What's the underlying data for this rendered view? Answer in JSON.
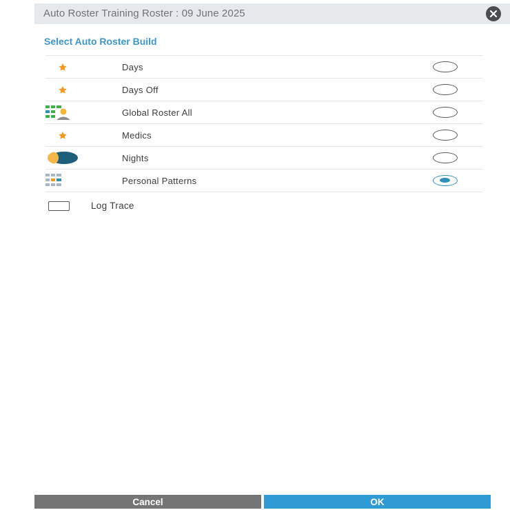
{
  "dialog": {
    "title": "Auto Roster Training Roster : 09 June 2025",
    "close_icon": "close-circle-icon"
  },
  "section": {
    "title": "Select Auto Roster Build"
  },
  "options": [
    {
      "label": "Days",
      "icon": "star-icon",
      "selected": false
    },
    {
      "label": "Days Off",
      "icon": "star-icon",
      "selected": false
    },
    {
      "label": "Global Roster All",
      "icon": "roster-person-icon",
      "selected": false
    },
    {
      "label": "Medics",
      "icon": "star-icon",
      "selected": false
    },
    {
      "label": "Nights",
      "icon": "moon-icon",
      "selected": false
    },
    {
      "label": "Personal Patterns",
      "icon": "pattern-grid-icon",
      "selected": true
    }
  ],
  "log_trace": {
    "label": "Log Trace",
    "checked": false
  },
  "buttons": {
    "cancel": "Cancel",
    "ok": "OK"
  },
  "colors": {
    "accent": "#3e97c1",
    "ok_button": "#2f9ad4",
    "cancel_button": "#757575",
    "star": "#f39a1e",
    "title_bar": "#e6e9ec"
  }
}
